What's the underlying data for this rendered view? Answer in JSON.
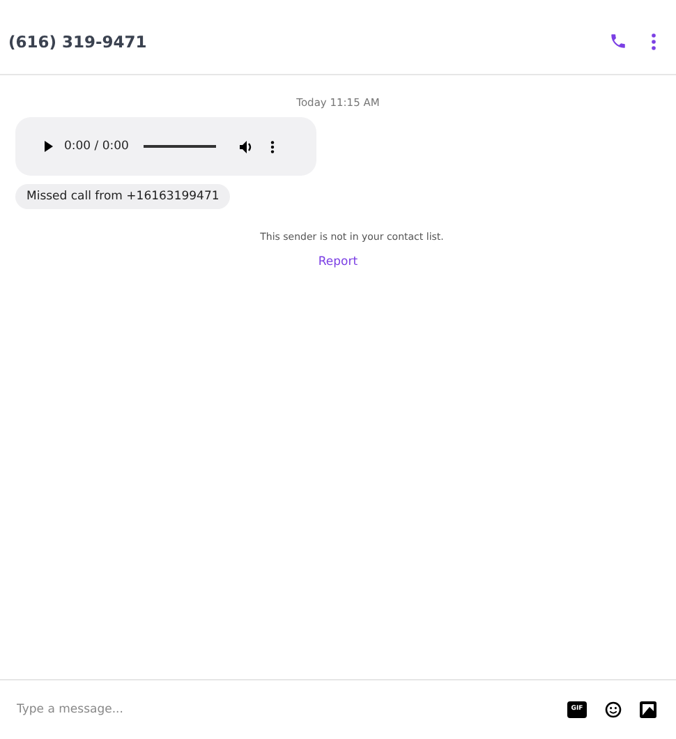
{
  "header": {
    "title": "(616) 319-9471"
  },
  "messages": [
    {
      "kind": "timestamp",
      "text": "Today 11:15 AM"
    },
    {
      "kind": "audio",
      "time": "0:00 / 0:00"
    },
    {
      "kind": "text",
      "text": "Missed call from +16163199471"
    },
    {
      "kind": "notice",
      "text": "This sender is not in your contact list."
    },
    {
      "kind": "link",
      "text": "Report"
    }
  ],
  "composer": {
    "placeholder": "Type a message...",
    "gif_label": "GIF"
  }
}
